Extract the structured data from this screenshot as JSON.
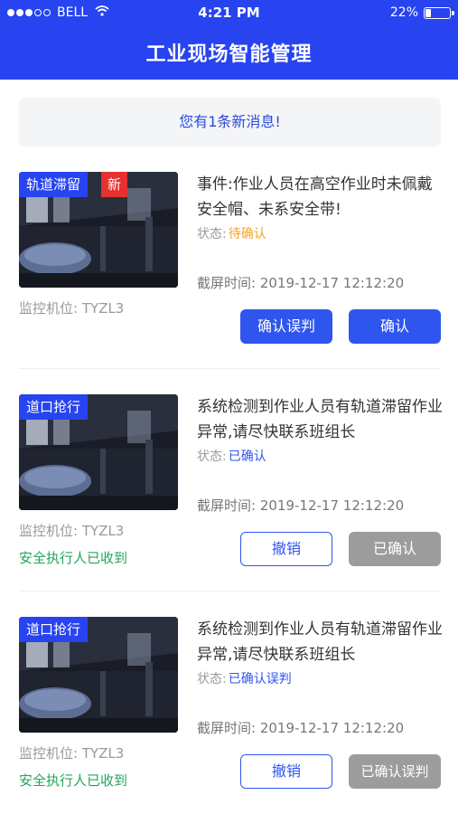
{
  "status_bar": {
    "carrier": "BELL",
    "time": "4:21 PM",
    "battery": "22%",
    "battery_level": 0.22
  },
  "header": {
    "title": "工业现场智能管理"
  },
  "notice": {
    "text": "您有1条新消息!"
  },
  "labels": {
    "status_prefix": "状态:",
    "time_prefix": "截屏时间:",
    "camera_prefix": "监控机位:"
  },
  "cards": [
    {
      "tag": "轨道滞留",
      "new_badge": "新",
      "event": "事件:作业人员在高空作业时未佩戴安全帽、未系安全带!",
      "status": "待确认",
      "status_color": "#f5a623",
      "time": "2019-12-17 12:12:20",
      "camera": "TYZL3",
      "receipt": "",
      "button1": "确认误判",
      "button2": "确认"
    },
    {
      "tag": "道口抢行",
      "new_badge": "",
      "event": "系统检测到作业人员有轨道滞留作业异常,请尽快联系班组长",
      "status": "已确认",
      "status_color": "#2f55ef",
      "time": "2019-12-17 12:12:20",
      "camera": "TYZL3",
      "receipt": "安全执行人已收到",
      "button1": "撤销",
      "button2": "已确认"
    },
    {
      "tag": "道口抢行",
      "new_badge": "",
      "event": "系统检测到作业人员有轨道滞留作业异常,请尽快联系班组长",
      "status": "已确认误判",
      "status_color": "#2f55ef",
      "time": "2019-12-17 12:12:20",
      "camera": "TYZL3",
      "receipt": "安全执行人已收到",
      "button1": "撤销",
      "button2": "已确认误判"
    }
  ],
  "colors": {
    "brand": "#2744f0",
    "button_primary": "#2f55ef",
    "new_badge": "#e5312f",
    "disabled": "#9c9c9c",
    "success": "#23a55a"
  }
}
